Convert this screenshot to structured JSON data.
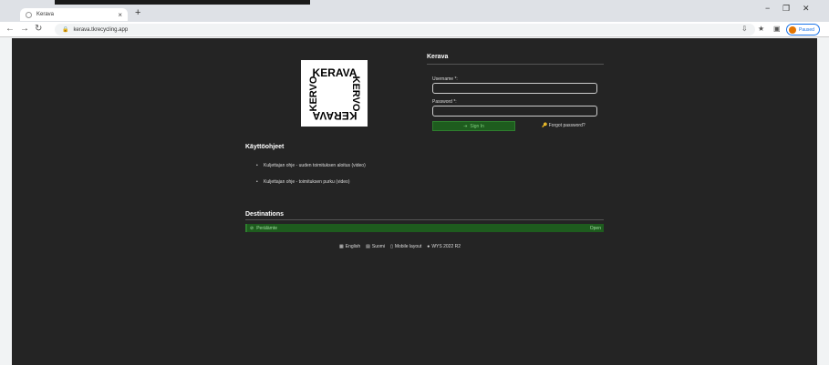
{
  "browser": {
    "tab_title": "Kerava",
    "tab_close": "×",
    "new_tab": "+",
    "url": "kerava.tkrecycling.app",
    "profile_status": "Paused",
    "win_min": "−",
    "win_max": "❐",
    "win_close": "✕"
  },
  "login": {
    "panel_title": "Kerava",
    "username_label": "Username *:",
    "password_label": "Password *:",
    "signin_label": "Sign In",
    "forgot_label": "Forgot password?"
  },
  "instructions": {
    "heading": "Käyttöohjeet",
    "items": [
      "Kuljettajan ohje - uuden toimituksen aloitus (video)",
      "Kuljettajan ohje - toimituksen purku (video)"
    ]
  },
  "destinations": {
    "heading": "Destinations",
    "rows": [
      {
        "name": "Perälämte",
        "status": "Open"
      }
    ]
  },
  "footer": {
    "english": "English",
    "suomi": "Suomi",
    "mobile": "Mobile layout",
    "version": "WYS 2022 R2"
  },
  "logo": {
    "top": "KERAVA",
    "side": "KERVO"
  }
}
